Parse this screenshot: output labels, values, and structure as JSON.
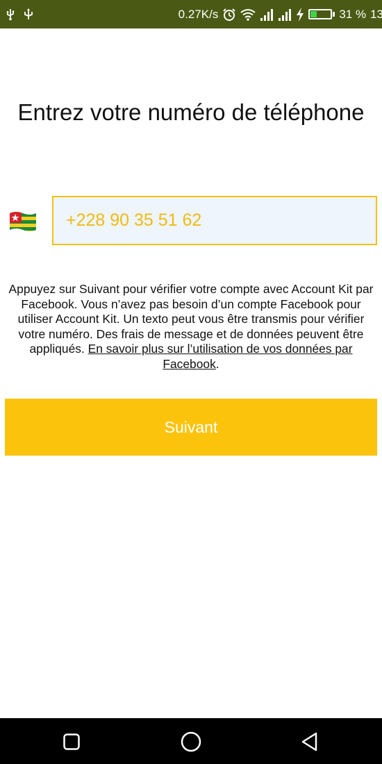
{
  "status_bar": {
    "network_speed": "0.27K/s",
    "battery_percent": "31 %",
    "time_partial": "13",
    "battery_level": 0.31,
    "icons": [
      "usb-icon",
      "usb-icon",
      "alarm-icon",
      "wifi-icon",
      "signal-icon",
      "signal-icon",
      "charging-icon",
      "battery-icon"
    ]
  },
  "page": {
    "title": "Entrez votre numéro de téléphone"
  },
  "phone": {
    "country_flag": "togo-flag-icon",
    "value": "+228 90 35 51 62"
  },
  "disclaimer": {
    "text": "Appuyez sur Suivant pour vérifier votre compte avec Account Kit par Facebook. Vous n’avez pas besoin d’un compte Facebook pour utiliser Account Kit. Un texto peut vous être transmis pour vérifier votre numéro. Des frais de message et de données peuvent être appliqués. ",
    "link_text": "En savoir plus sur l’utilisation de vos données par Facebook",
    "trailing": "."
  },
  "actions": {
    "next_label": "Suivant"
  },
  "navigation": {
    "icons": [
      "recent-apps-icon",
      "home-icon",
      "back-icon"
    ]
  },
  "colors": {
    "status_bar": "#4a5a14",
    "accent": "#fbc30c",
    "input_border": "#f2c211",
    "input_bg": "#eef5fc",
    "input_text": "#f1ba12"
  }
}
